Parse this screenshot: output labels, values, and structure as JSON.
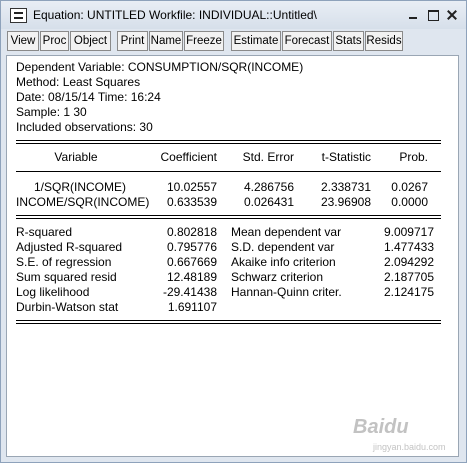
{
  "window": {
    "title": "Equation: UNTITLED   Workfile: INDIVIDUAL::Untitled\\"
  },
  "toolbar": {
    "buttons": [
      "View",
      "Proc",
      "Object",
      "Print",
      "Name",
      "Freeze",
      "Estimate",
      "Forecast",
      "Stats",
      "Resids"
    ]
  },
  "output": {
    "header": [
      "Dependent Variable: CONSUMPTION/SQR(INCOME)",
      "Method: Least Squares",
      "Date: 08/15/14   Time: 16:24",
      "Sample: 1 30",
      "Included observations: 30"
    ],
    "columns": [
      "Variable",
      "Coefficient",
      "Std. Error",
      "t-Statistic",
      "Prob."
    ],
    "rows": [
      {
        "variable": "1/SQR(INCOME)",
        "coefficient": "10.02557",
        "std_error": "4.286756",
        "t_stat": "2.338731",
        "prob": "0.0267"
      },
      {
        "variable": "INCOME/SQR(INCOME)",
        "coefficient": "0.633539",
        "std_error": "0.026431",
        "t_stat": "23.96908",
        "prob": "0.0000"
      }
    ],
    "stats_left": [
      {
        "label": "R-squared",
        "value": "0.802818"
      },
      {
        "label": "Adjusted R-squared",
        "value": "0.795776"
      },
      {
        "label": "S.E. of regression",
        "value": "0.667669"
      },
      {
        "label": "Sum squared resid",
        "value": "12.48189"
      },
      {
        "label": "Log likelihood",
        "value": "-29.41438"
      },
      {
        "label": "Durbin-Watson stat",
        "value": "1.691107"
      }
    ],
    "stats_right": [
      {
        "label": "Mean dependent var",
        "value": "9.009717"
      },
      {
        "label": "S.D. dependent var",
        "value": "1.477433"
      },
      {
        "label": "Akaike info criterion",
        "value": "2.094292"
      },
      {
        "label": "Schwarz criterion",
        "value": "2.187705"
      },
      {
        "label": "Hannan-Quinn criter.",
        "value": "2.124175"
      }
    ]
  },
  "watermark": {
    "text": "Baidu",
    "sub": "jingyan.baidu.com"
  }
}
